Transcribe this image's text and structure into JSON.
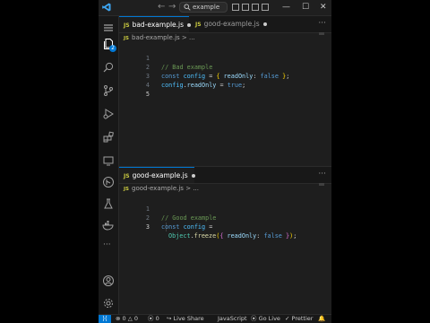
{
  "titlebar": {
    "search_text": "example",
    "back_icon": "arrow-left-icon",
    "forward_icon": "arrow-right-icon",
    "minimize_glyph": "—",
    "maximize_glyph": "☐",
    "close_glyph": "✕"
  },
  "activity_bar": {
    "explorer_badge": "2",
    "more_glyph": "···"
  },
  "top_editor": {
    "tabs": [
      {
        "label": "bad-example.js",
        "active": true,
        "modified": true
      },
      {
        "label": "good-example.js",
        "active": false,
        "modified": true
      }
    ],
    "tab_more": "···",
    "breadcrumb": {
      "file": "bad-example.js",
      "sep": ">",
      "rest": "..."
    },
    "lines": [
      {
        "num": "1",
        "text": "// Bad example"
      },
      {
        "num": "2",
        "kw": "const",
        "var": "config",
        "eq": " = ",
        "b1": "{",
        "prop": "readOnly",
        "colon": ": ",
        "val": "false",
        "b2": "}",
        "semi": ";"
      },
      {
        "num": "3",
        "var": "config",
        "dot": ".",
        "prop": "readOnly",
        "eq": " = ",
        "val": "true",
        "semi": ";"
      },
      {
        "num": "4"
      },
      {
        "num": "5"
      }
    ]
  },
  "bottom_editor": {
    "tabs": [
      {
        "label": "good-example.js",
        "active": true,
        "modified": true
      }
    ],
    "tab_more": "···",
    "breadcrumb": {
      "file": "good-example.js",
      "sep": ">",
      "rest": "..."
    },
    "lines": [
      {
        "num": "1",
        "text": "// Good example"
      },
      {
        "num": "2",
        "kw": "const",
        "var": "config",
        "eq": " ="
      },
      {
        "num": "3",
        "cls": "Object",
        "dot": ".",
        "fn": "freeze",
        "p1": "(",
        "b1": "{",
        "prop": "readOnly",
        "colon": ": ",
        "val": "false",
        "b2": "}",
        "p2": ")",
        "semi": ";"
      }
    ]
  },
  "status_bar": {
    "remote_glyph": "⟩⟨",
    "errors": "0",
    "warnings": "0",
    "ports": "0",
    "live_share": "Live Share",
    "language": "JavaScript",
    "go_live": "Go Live",
    "prettier": "Prettier"
  },
  "colors": {
    "accent": "#0078d4",
    "editor_bg": "#1e1e1e",
    "comment": "#6a9955",
    "keyword": "#569cd6"
  }
}
